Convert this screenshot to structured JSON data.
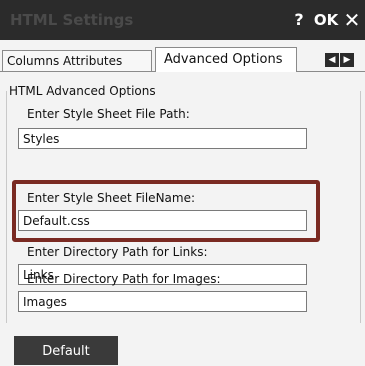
{
  "window": {
    "title": "HTML Settings",
    "help_label": "?",
    "ok_label": "OK",
    "close_label": "✕"
  },
  "tabs": [
    {
      "label": "Columns Attributes",
      "selected": false
    },
    {
      "label": "Advanced Options",
      "selected": true
    }
  ],
  "tab_scroll": {
    "left_icon": "◀",
    "right_icon": "▶"
  },
  "group": {
    "title": "HTML Advanced Options"
  },
  "fields": [
    {
      "label": "Enter Style Sheet File Path:",
      "value": "Styles"
    },
    {
      "label": "Enter Style Sheet FileName:",
      "value": "Default.css",
      "highlighted": true
    },
    {
      "label": "Enter Directory Path for Links:",
      "value": "Links"
    },
    {
      "label": "Enter Directory Path for Images:",
      "value": "Images"
    }
  ],
  "buttons": {
    "default_label": "Default"
  },
  "colors": {
    "titlebar": "#2b2b2b",
    "highlight_border": "#7a2a22",
    "button_bg": "#3a3a3a",
    "background": "#f3f3f3"
  }
}
